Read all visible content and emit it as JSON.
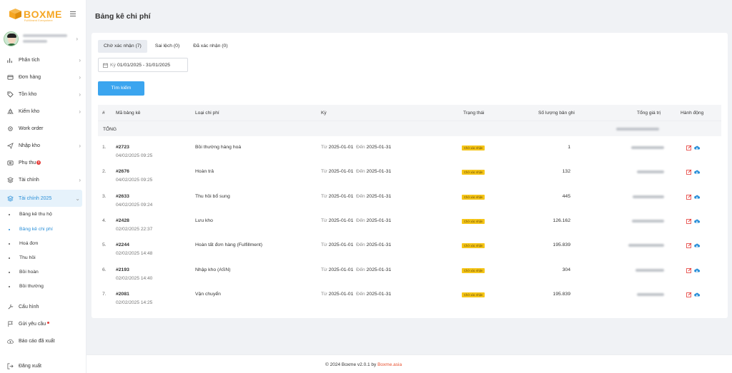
{
  "app": {
    "logo_text": "BOXME",
    "logo_sub": "Fulfillment Everywhere",
    "page_title": "Bảng kê chi phí"
  },
  "colors": {
    "brand": "#f5a623",
    "primary": "#3ba5ef",
    "active_text": "#2a8fd8",
    "status_pending": "#f5c518",
    "footer_link": "#e8502f"
  },
  "sidebar": {
    "items": [
      {
        "label": "Phân tích",
        "icon": "analytics-icon"
      },
      {
        "label": "Đơn hàng",
        "icon": "orders-icon"
      },
      {
        "label": "Tồn kho",
        "icon": "tag-icon"
      },
      {
        "label": "Kiểm kho",
        "icon": "recycle-icon"
      },
      {
        "label": "Work order",
        "icon": "gear-icon"
      },
      {
        "label": "Nhập kho",
        "icon": "plane-icon"
      },
      {
        "label": "Phụ thu",
        "icon": "coin-icon",
        "badge": "0"
      },
      {
        "label": "Tài chính",
        "icon": "layers-icon"
      },
      {
        "label": "Tài chính 2025",
        "icon": "layers-icon"
      }
    ],
    "sub_items": [
      "Bảng kê thu hộ",
      "Bảng kê chi phí",
      "Hoá đơn",
      "Thu hồi",
      "Bồi hoàn",
      "Bồi thường"
    ],
    "bottom_items": [
      {
        "label": "Cấu hình",
        "icon": "wrench-icon"
      },
      {
        "label": "Gửi yêu cầu",
        "icon": "flag-icon"
      },
      {
        "label": "Báo cáo đã xuất",
        "icon": "cloud-upload-icon"
      }
    ],
    "logout": "Đăng xuất"
  },
  "tabs": [
    "Chờ xác nhận (7)",
    "Sai lệch (0)",
    "Đã xác nhận (0)"
  ],
  "filter": {
    "period_prefix": "Kỳ",
    "period_value": "01/01/2025 - 31/01/2025",
    "search_button": "Tìm kiếm"
  },
  "table": {
    "headers": [
      "#",
      "Mã bảng kê",
      "Loại chi phí",
      "Kỳ",
      "Trạng thái",
      "Số lượng bản ghi",
      "Tổng giá trị",
      "Hành động"
    ],
    "total_label": "TỔNG",
    "from_label": "Từ",
    "to_label": "Đến",
    "rows": [
      {
        "num": "1.",
        "code": "#2723",
        "time": "04/02/2025 09:25",
        "type": "Bồi thường hàng hoá",
        "from": "2025-01-01",
        "to": "2025-01-31",
        "status": "Chờ xác nhận",
        "count": "1"
      },
      {
        "num": "2.",
        "code": "#2676",
        "time": "04/02/2025 09:25",
        "type": "Hoàn trả",
        "from": "2025-01-01",
        "to": "2025-01-31",
        "status": "Chờ xác nhận",
        "count": "132"
      },
      {
        "num": "3.",
        "code": "#2633",
        "time": "04/02/2025 09:24",
        "type": "Thu hồi bổ sung",
        "from": "2025-01-01",
        "to": "2025-01-31",
        "status": "Chờ xác nhận",
        "count": "445"
      },
      {
        "num": "4.",
        "code": "#2428",
        "time": "02/02/2025 22:37",
        "type": "Lưu kho",
        "from": "2025-01-01",
        "to": "2025-01-31",
        "status": "Chờ xác nhận",
        "count": "126.162"
      },
      {
        "num": "5.",
        "code": "#2244",
        "time": "02/02/2025 14:48",
        "type": "Hoàn tất đơn hàng (Fulfillment)",
        "from": "2025-01-01",
        "to": "2025-01-31",
        "status": "Chờ xác nhận",
        "count": "195.839"
      },
      {
        "num": "6.",
        "code": "#2193",
        "time": "02/02/2025 14:40",
        "type": "Nhập kho (ASN)",
        "from": "2025-01-01",
        "to": "2025-01-31",
        "status": "Chờ xác nhận",
        "count": "304"
      },
      {
        "num": "7.",
        "code": "#2081",
        "time": "02/02/2025 14:25",
        "type": "Vận chuyển",
        "from": "2025-01-01",
        "to": "2025-01-31",
        "status": "Chờ xác nhận",
        "count": "195.839"
      }
    ]
  },
  "footer": {
    "text": "© 2024 Boxme v2.0.1 by",
    "link": "Boxme.asia"
  }
}
